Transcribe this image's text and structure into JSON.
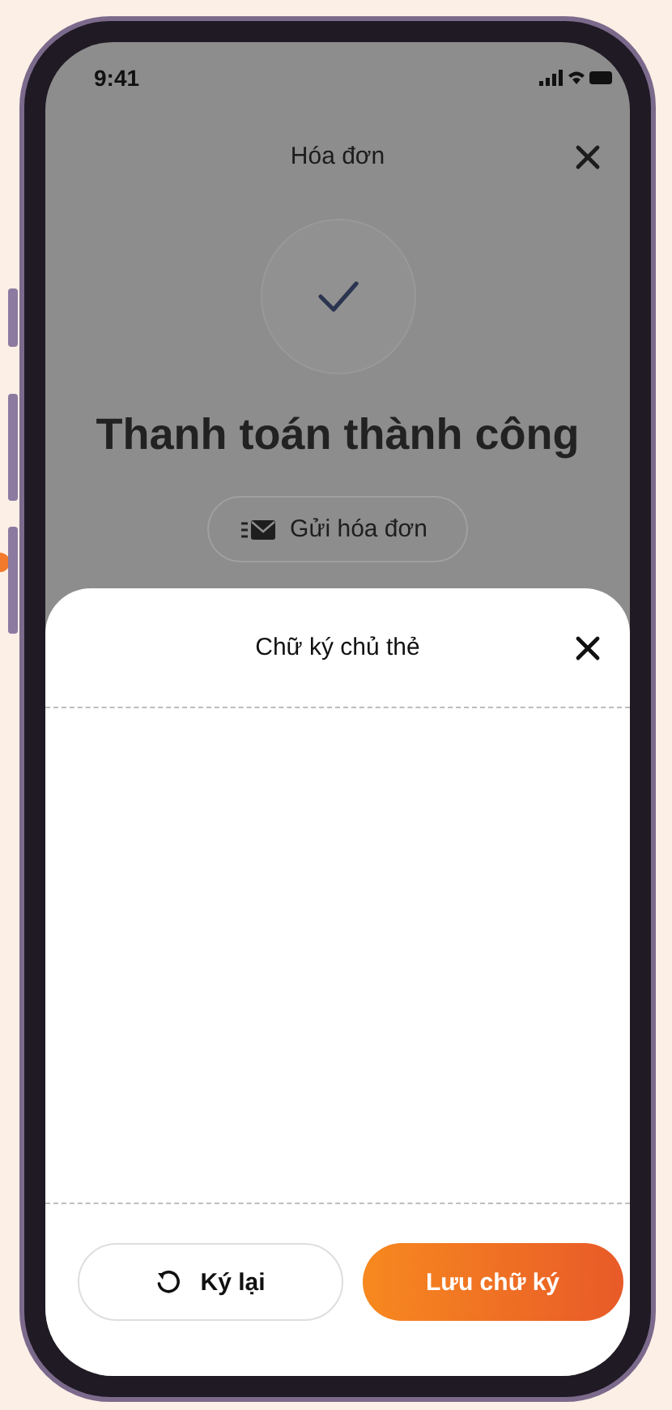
{
  "status_bar": {
    "time": "9:41"
  },
  "header": {
    "title": "Hóa đơn"
  },
  "result": {
    "title": "Thanh toán thành công",
    "send_button": "Gửi hóa đơn"
  },
  "signature_sheet": {
    "title": "Chữ ký chủ thẻ",
    "buttons": [
      {
        "kind": "retry",
        "label": "Ký lại"
      },
      {
        "kind": "save",
        "label": "Lưu chữ ký"
      }
    ]
  }
}
